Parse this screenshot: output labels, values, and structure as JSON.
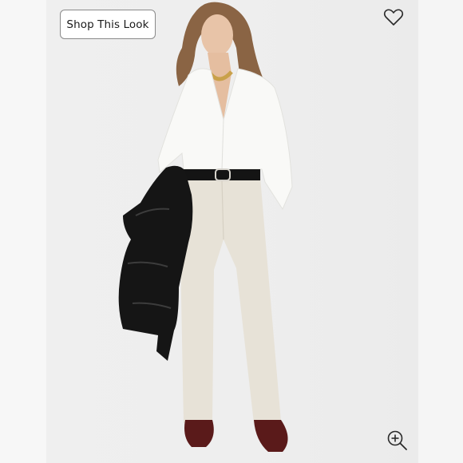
{
  "actions": {
    "shop_look_label": "Shop This Look"
  },
  "icons": {
    "favorite": "heart-icon",
    "zoom": "zoom-in-icon"
  },
  "colors": {
    "background": "#eeeeee",
    "button_border": "#8a8a8a",
    "button_text": "#1a1a1a",
    "icon_stroke": "#2a2a2a"
  }
}
